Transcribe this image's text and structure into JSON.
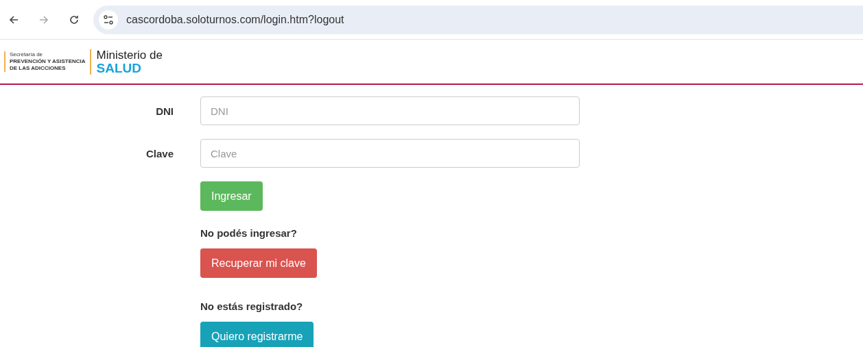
{
  "browser": {
    "url": "cascordoba.soloturnos.com/login.htm?logout"
  },
  "header": {
    "secretaria": [
      "Secretaría de",
      "PREVENCIÓN Y ASISTENCIA",
      "DE LAS ADICCIONES"
    ],
    "ministerio": "Ministerio de",
    "salud": "SALUD"
  },
  "fields": [
    {
      "label": "DNI",
      "placeholder": "DNI"
    },
    {
      "label": "Clave",
      "placeholder": "Clave"
    }
  ],
  "items": [
    {
      "kind": "submit",
      "label": "Ingresar"
    },
    {
      "kind": "prompt",
      "text": "No podés ingresar?"
    },
    {
      "kind": "recover",
      "label": "Recuperar mi clave"
    },
    {
      "kind": "prompt",
      "text": "No estás registrado?"
    },
    {
      "kind": "register",
      "label": "Quiero registrarme"
    }
  ]
}
